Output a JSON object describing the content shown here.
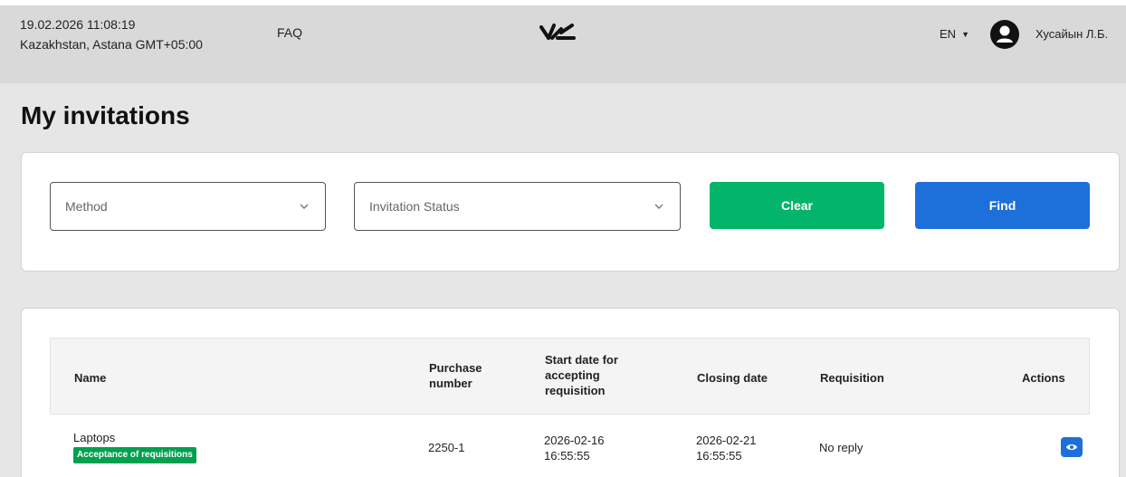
{
  "header": {
    "datetime": "19.02.2026 11:08:19",
    "timezone": "Kazakhstan, Astana GMT+05:00",
    "faq": "FAQ",
    "language": "EN",
    "user_name": "Хусайын Л.Б."
  },
  "page": {
    "title": "My invitations"
  },
  "filters": {
    "method_placeholder": "Method",
    "status_placeholder": "Invitation Status",
    "clear_label": "Clear",
    "find_label": "Find"
  },
  "table": {
    "headers": {
      "name": "Name",
      "purchase_line1": "Purchase",
      "purchase_line2": "number",
      "start_line1": "Start date for",
      "start_line2": "accepting",
      "start_line3": "requisition",
      "closing": "Closing date",
      "requisition": "Requisition",
      "actions": "Actions"
    },
    "rows": [
      {
        "name": "Laptops",
        "status_badge": "Acceptance of requisitions",
        "purchase_number": "2250-1",
        "start_date": "2026-02-16",
        "start_time": "16:55:55",
        "closing_date": "2026-02-21",
        "closing_time": "16:55:55",
        "requisition": "No reply",
        "action_icon": "eye-icon"
      }
    ]
  },
  "colors": {
    "header_bg": "#d9d9d9",
    "clear_green": "#03b56a",
    "find_blue": "#1d6fd9",
    "badge_green": "#03a04f"
  }
}
